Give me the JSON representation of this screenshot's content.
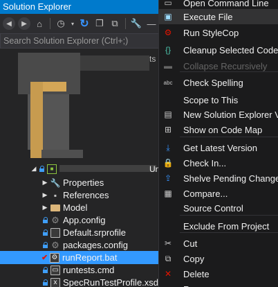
{
  "explorer": {
    "title": "Solution Explorer",
    "search_placeholder": "Search Solution Explorer (Ctrl+;)",
    "obscured_suffixes": {
      "row1": "ts",
      "project": "Un"
    },
    "tree": [
      {
        "label": "Properties",
        "icon": "wrench-icon",
        "arrow": "▶"
      },
      {
        "label": "References",
        "icon": "references-icon",
        "arrow": "▶"
      },
      {
        "label": "Model",
        "icon": "folder-icon",
        "arrow": "▶"
      },
      {
        "label": "App.config",
        "icon": "config-file-icon",
        "lock": true
      },
      {
        "label": "Default.srprofile",
        "icon": "file-icon",
        "lock": true
      },
      {
        "label": "packages.config",
        "icon": "config-file-icon",
        "lock": true
      },
      {
        "label": "runReport.bat",
        "icon": "batch-file-icon",
        "check": "✔",
        "selected": true
      },
      {
        "label": "runtests.cmd",
        "icon": "cmd-file-icon",
        "lock": true
      },
      {
        "label": "SpecRunTestProfile.xsd",
        "icon": "xsd-file-icon",
        "lock": true
      }
    ]
  },
  "context_menu": {
    "items": [
      {
        "label": "Open Command Line",
        "icon": "command-line-icon"
      },
      {
        "label": "Execute File",
        "icon": "execute-file-icon",
        "highlight": true
      },
      {
        "label": "Run StyleCop",
        "icon": "stylecop-icon"
      },
      {
        "label": "Cleanup Selected Code",
        "icon": "cleanup-icon"
      },
      {
        "label": "Collapse Recursively",
        "icon": "collapse-icon",
        "disabled": true
      },
      {
        "label": "Check Spelling",
        "icon": "spelling-icon"
      },
      {
        "label": "Scope to This",
        "icon": ""
      },
      {
        "label": "New Solution Explorer V",
        "icon": "new-explorer-icon"
      },
      {
        "label": "Show on Code Map",
        "icon": "code-map-icon"
      },
      {
        "label": "Get Latest Version",
        "icon": "get-latest-icon"
      },
      {
        "label": "Check In...",
        "icon": "check-in-icon"
      },
      {
        "label": "Shelve Pending Changes",
        "icon": "shelve-icon"
      },
      {
        "label": "Compare...",
        "icon": "compare-icon"
      },
      {
        "label": "Source Control",
        "icon": ""
      },
      {
        "label": "Exclude From Project",
        "icon": ""
      },
      {
        "label": "Cut",
        "icon": "cut-icon"
      },
      {
        "label": "Copy",
        "icon": "copy-icon"
      },
      {
        "label": "Delete",
        "icon": "delete-icon"
      },
      {
        "label": "Rename",
        "icon": ""
      }
    ]
  }
}
